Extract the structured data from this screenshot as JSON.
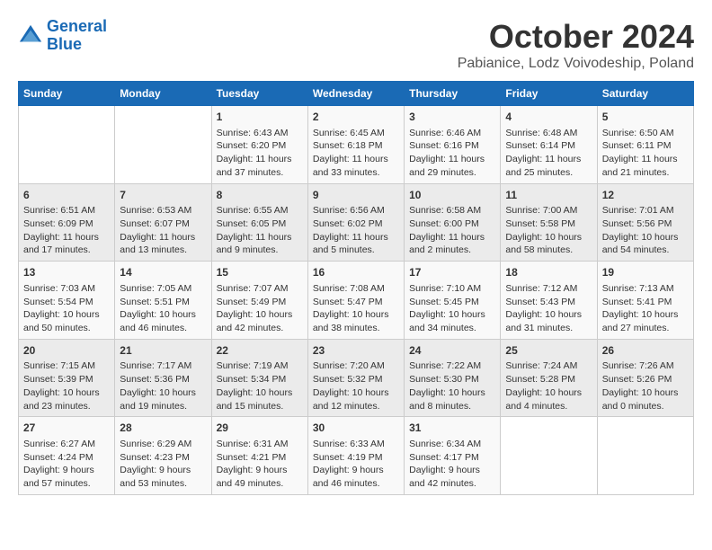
{
  "header": {
    "logo_line1": "General",
    "logo_line2": "Blue",
    "title": "October 2024",
    "subtitle": "Pabianice, Lodz Voivodeship, Poland"
  },
  "days_of_week": [
    "Sunday",
    "Monday",
    "Tuesday",
    "Wednesday",
    "Thursday",
    "Friday",
    "Saturday"
  ],
  "weeks": [
    [
      {
        "day": "",
        "content": ""
      },
      {
        "day": "",
        "content": ""
      },
      {
        "day": "1",
        "content": "Sunrise: 6:43 AM\nSunset: 6:20 PM\nDaylight: 11 hours and 37 minutes."
      },
      {
        "day": "2",
        "content": "Sunrise: 6:45 AM\nSunset: 6:18 PM\nDaylight: 11 hours and 33 minutes."
      },
      {
        "day": "3",
        "content": "Sunrise: 6:46 AM\nSunset: 6:16 PM\nDaylight: 11 hours and 29 minutes."
      },
      {
        "day": "4",
        "content": "Sunrise: 6:48 AM\nSunset: 6:14 PM\nDaylight: 11 hours and 25 minutes."
      },
      {
        "day": "5",
        "content": "Sunrise: 6:50 AM\nSunset: 6:11 PM\nDaylight: 11 hours and 21 minutes."
      }
    ],
    [
      {
        "day": "6",
        "content": "Sunrise: 6:51 AM\nSunset: 6:09 PM\nDaylight: 11 hours and 17 minutes."
      },
      {
        "day": "7",
        "content": "Sunrise: 6:53 AM\nSunset: 6:07 PM\nDaylight: 11 hours and 13 minutes."
      },
      {
        "day": "8",
        "content": "Sunrise: 6:55 AM\nSunset: 6:05 PM\nDaylight: 11 hours and 9 minutes."
      },
      {
        "day": "9",
        "content": "Sunrise: 6:56 AM\nSunset: 6:02 PM\nDaylight: 11 hours and 5 minutes."
      },
      {
        "day": "10",
        "content": "Sunrise: 6:58 AM\nSunset: 6:00 PM\nDaylight: 11 hours and 2 minutes."
      },
      {
        "day": "11",
        "content": "Sunrise: 7:00 AM\nSunset: 5:58 PM\nDaylight: 10 hours and 58 minutes."
      },
      {
        "day": "12",
        "content": "Sunrise: 7:01 AM\nSunset: 5:56 PM\nDaylight: 10 hours and 54 minutes."
      }
    ],
    [
      {
        "day": "13",
        "content": "Sunrise: 7:03 AM\nSunset: 5:54 PM\nDaylight: 10 hours and 50 minutes."
      },
      {
        "day": "14",
        "content": "Sunrise: 7:05 AM\nSunset: 5:51 PM\nDaylight: 10 hours and 46 minutes."
      },
      {
        "day": "15",
        "content": "Sunrise: 7:07 AM\nSunset: 5:49 PM\nDaylight: 10 hours and 42 minutes."
      },
      {
        "day": "16",
        "content": "Sunrise: 7:08 AM\nSunset: 5:47 PM\nDaylight: 10 hours and 38 minutes."
      },
      {
        "day": "17",
        "content": "Sunrise: 7:10 AM\nSunset: 5:45 PM\nDaylight: 10 hours and 34 minutes."
      },
      {
        "day": "18",
        "content": "Sunrise: 7:12 AM\nSunset: 5:43 PM\nDaylight: 10 hours and 31 minutes."
      },
      {
        "day": "19",
        "content": "Sunrise: 7:13 AM\nSunset: 5:41 PM\nDaylight: 10 hours and 27 minutes."
      }
    ],
    [
      {
        "day": "20",
        "content": "Sunrise: 7:15 AM\nSunset: 5:39 PM\nDaylight: 10 hours and 23 minutes."
      },
      {
        "day": "21",
        "content": "Sunrise: 7:17 AM\nSunset: 5:36 PM\nDaylight: 10 hours and 19 minutes."
      },
      {
        "day": "22",
        "content": "Sunrise: 7:19 AM\nSunset: 5:34 PM\nDaylight: 10 hours and 15 minutes."
      },
      {
        "day": "23",
        "content": "Sunrise: 7:20 AM\nSunset: 5:32 PM\nDaylight: 10 hours and 12 minutes."
      },
      {
        "day": "24",
        "content": "Sunrise: 7:22 AM\nSunset: 5:30 PM\nDaylight: 10 hours and 8 minutes."
      },
      {
        "day": "25",
        "content": "Sunrise: 7:24 AM\nSunset: 5:28 PM\nDaylight: 10 hours and 4 minutes."
      },
      {
        "day": "26",
        "content": "Sunrise: 7:26 AM\nSunset: 5:26 PM\nDaylight: 10 hours and 0 minutes."
      }
    ],
    [
      {
        "day": "27",
        "content": "Sunrise: 6:27 AM\nSunset: 4:24 PM\nDaylight: 9 hours and 57 minutes."
      },
      {
        "day": "28",
        "content": "Sunrise: 6:29 AM\nSunset: 4:23 PM\nDaylight: 9 hours and 53 minutes."
      },
      {
        "day": "29",
        "content": "Sunrise: 6:31 AM\nSunset: 4:21 PM\nDaylight: 9 hours and 49 minutes."
      },
      {
        "day": "30",
        "content": "Sunrise: 6:33 AM\nSunset: 4:19 PM\nDaylight: 9 hours and 46 minutes."
      },
      {
        "day": "31",
        "content": "Sunrise: 6:34 AM\nSunset: 4:17 PM\nDaylight: 9 hours and 42 minutes."
      },
      {
        "day": "",
        "content": ""
      },
      {
        "day": "",
        "content": ""
      }
    ]
  ]
}
